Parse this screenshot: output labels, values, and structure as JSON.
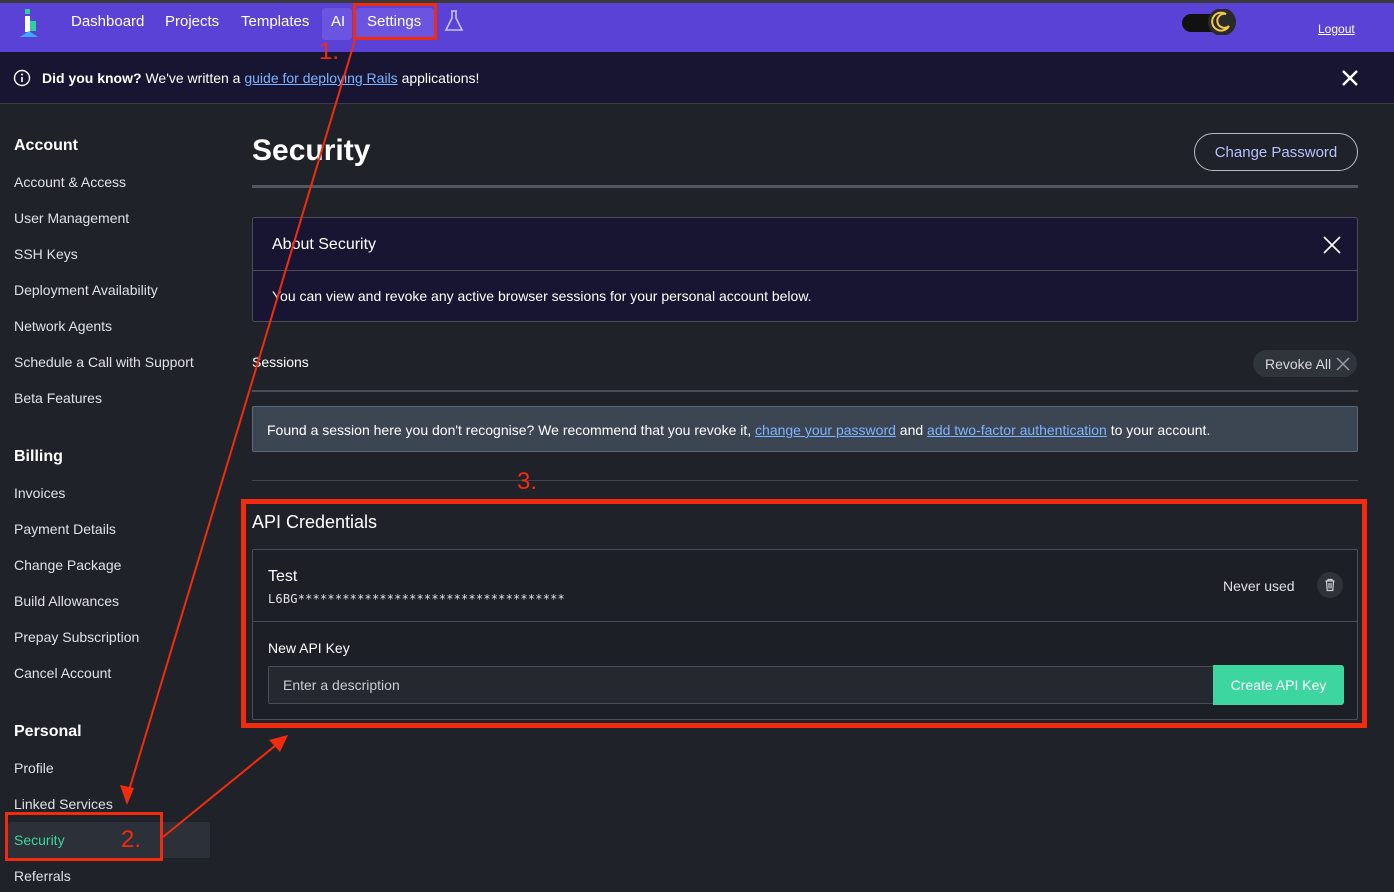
{
  "nav": {
    "items": [
      "Dashboard",
      "Projects",
      "Templates",
      "AI",
      "Settings"
    ],
    "logout": "Logout"
  },
  "banner": {
    "lead": "Did you know?",
    "text_before": " We've written a ",
    "link": "guide for deploying Rails",
    "text_after": " applications!"
  },
  "sidebar": {
    "sections": [
      {
        "heading": "Account",
        "items": [
          "Account & Access",
          "User Management",
          "SSH Keys",
          "Deployment Availability",
          "Network Agents",
          "Schedule a Call with Support",
          "Beta Features"
        ]
      },
      {
        "heading": "Billing",
        "items": [
          "Invoices",
          "Payment Details",
          "Change Package",
          "Build Allowances",
          "Prepay Subscription",
          "Cancel Account"
        ]
      },
      {
        "heading": "Personal",
        "items": [
          "Profile",
          "Linked Services",
          "Security",
          "Referrals"
        ]
      }
    ],
    "active": "Security"
  },
  "main": {
    "title": "Security",
    "change_password": "Change Password",
    "about": {
      "title": "About Security",
      "body": "You can view and revoke any active browser sessions for your personal account below."
    },
    "sessions": {
      "label": "Sessions",
      "revoke_all": "Revoke All"
    },
    "warning": {
      "text_1": "Found a session here you don't recognise? We recommend that you revoke it, ",
      "link_1": "change your password",
      "text_2": " and ",
      "link_2": "add two-factor authentication",
      "text_3": " to your account."
    },
    "api": {
      "title": "API Credentials",
      "key_name": "Test",
      "key_masked": "L6BG************************************",
      "key_status": "Never used",
      "new_key_label": "New API Key",
      "placeholder": "Enter a description",
      "create_button": "Create API Key"
    }
  },
  "annotations": {
    "step1": "1.",
    "step2": "2.",
    "step3": "3.",
    "color": "#f22b0e"
  },
  "colors": {
    "nav_bg": "#5b42d6",
    "accent_green": "#3ed6a0",
    "link_blue": "#7db3ff"
  }
}
